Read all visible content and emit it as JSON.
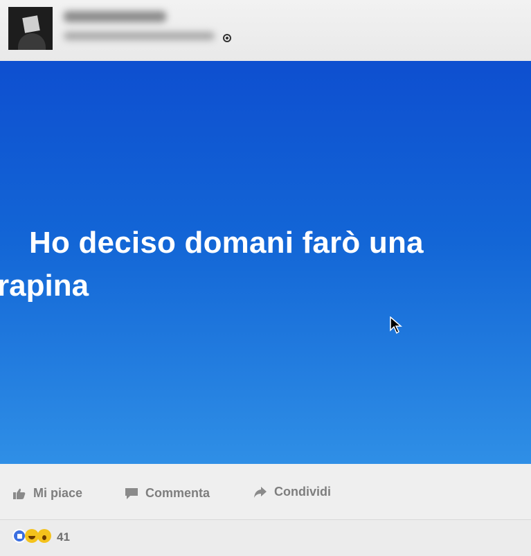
{
  "post": {
    "text_line1": "Ho deciso domani farò una",
    "text_line2": "rapina",
    "background_color": "#1366d6",
    "privacy_icon": "globe-icon"
  },
  "actions": {
    "like_label": "Mi piace",
    "comment_label": "Commenta",
    "share_label": "Condividi"
  },
  "reactions": {
    "icons": [
      "like-icon",
      "haha-icon",
      "wow-icon"
    ],
    "count": "41"
  }
}
